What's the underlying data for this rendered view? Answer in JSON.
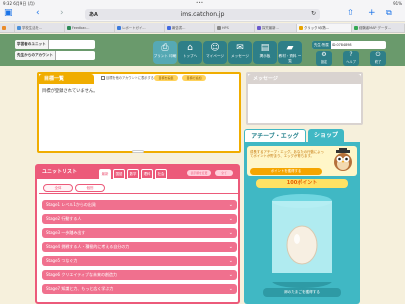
{
  "status_bar": {
    "time": "9:32",
    "date": "6月9日 (月)",
    "battery": "91%"
  },
  "browser": {
    "address": "ims.catchon.jp",
    "aa_label": "あA",
    "tabs": [
      {
        "label": ""
      },
      {
        "label": "学校生活を..."
      },
      {
        "label": "Feedbac..."
      },
      {
        "label": "レポートガイ..."
      },
      {
        "label": "報告書..."
      },
      {
        "label": "HPS"
      },
      {
        "label": "探究最新..."
      },
      {
        "label": "クリック!の熟..."
      },
      {
        "label": "経験者MAP データ..."
      }
    ]
  },
  "header": {
    "user_label": "学習者のユニット",
    "account_label": "先生からのアカウント",
    "nav": [
      {
        "label": "プリント\n印刷",
        "icon": "printer-icon"
      },
      {
        "label": "トップへ",
        "icon": "home-icon"
      },
      {
        "label": "マイページ",
        "icon": "person-icon"
      },
      {
        "label": "メッセージ",
        "icon": "mail-icon"
      },
      {
        "label": "掲示板",
        "icon": "board-icon"
      },
      {
        "label": "教材・資料\nー覧",
        "icon": "folder-icon"
      }
    ],
    "school_label": "先生:所属",
    "school_value": "ID:0784898",
    "small_buttons": [
      {
        "label": "設定",
        "icon": "gear-icon"
      },
      {
        "label": "ヘルプ",
        "icon": "help-icon"
      },
      {
        "label": "終了",
        "icon": "logout-icon"
      }
    ]
  },
  "goals": {
    "title": "目標一覧",
    "checkbox_label": "目標を他のアカウントに表示する",
    "buttons": [
      "目標を編集",
      "目標の追加"
    ],
    "empty_text": "目標が登録されていません。"
  },
  "message": {
    "title": "メッセージ"
  },
  "units": {
    "title": "ユニットリスト",
    "tabs": [
      "最新",
      "国語",
      "数学",
      "理科",
      "社会"
    ],
    "options": [
      "表示順を変更",
      "全て"
    ],
    "subtabs": [
      "全体",
      "個別"
    ],
    "rows": [
      "Stage1 レベル1からの出発",
      "Stage2 行動する人",
      "Stage3 一歩踏み出す",
      "Stage4 挑戦する人・積極的に考える自分の力",
      "Stage5 つなぐ力",
      "Stage6 クリエイティブな未来の創造力",
      "Stage7 知識と力、もっと広く学ぶ力"
    ]
  },
  "achieve": {
    "tab_main": "アチーブ・エッグ",
    "tab_shop": "ショップ",
    "info_text": "成長するアチーブ・エッグ。あなたの行動によってポイントが貯まり、エッグが育ちます。",
    "help_label": "ポイントを獲得する",
    "points": "100ポイント",
    "exchange_label": "卵のたまごを獲得する"
  },
  "colors": {
    "accent": "#2e7f88",
    "header": "#6a9a6c",
    "pink": "#ec5a7a",
    "teal": "#40b8c4",
    "orange": "#f0ad00"
  }
}
